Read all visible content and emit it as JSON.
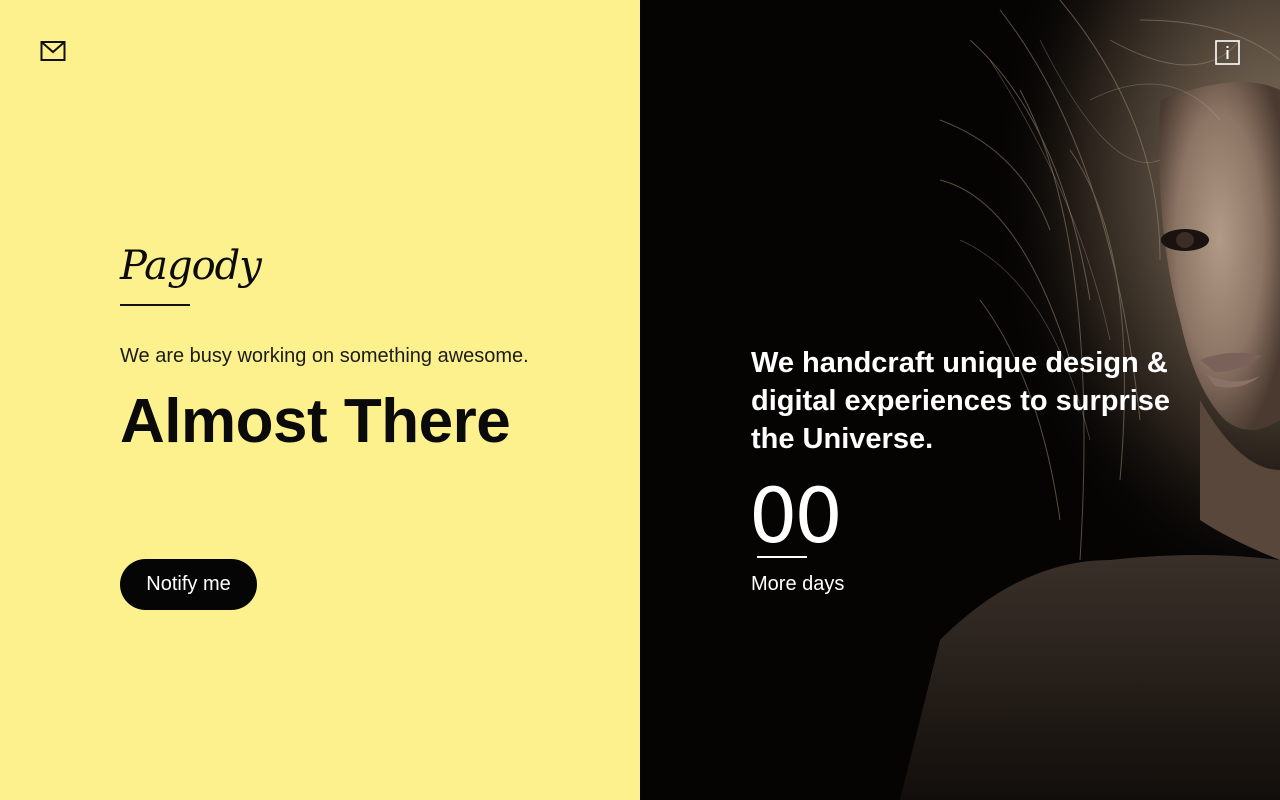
{
  "brand": {
    "name": "Pagody"
  },
  "hero": {
    "tagline": "We are busy working on something awesome.",
    "headline": "Almost There",
    "notify_label": "Notify me"
  },
  "panel": {
    "statement": "We handcraft unique design & digital experiences to surprise the Universe.",
    "counter_value": "00",
    "counter_label": "More days"
  },
  "icons": {
    "mail": "mail-icon",
    "info": "info-icon"
  },
  "colors": {
    "left_background": "#fcf18c",
    "right_background": "#050403",
    "button": "#050505",
    "text_dark": "#0a0a0a",
    "text_light": "#ffffff"
  }
}
